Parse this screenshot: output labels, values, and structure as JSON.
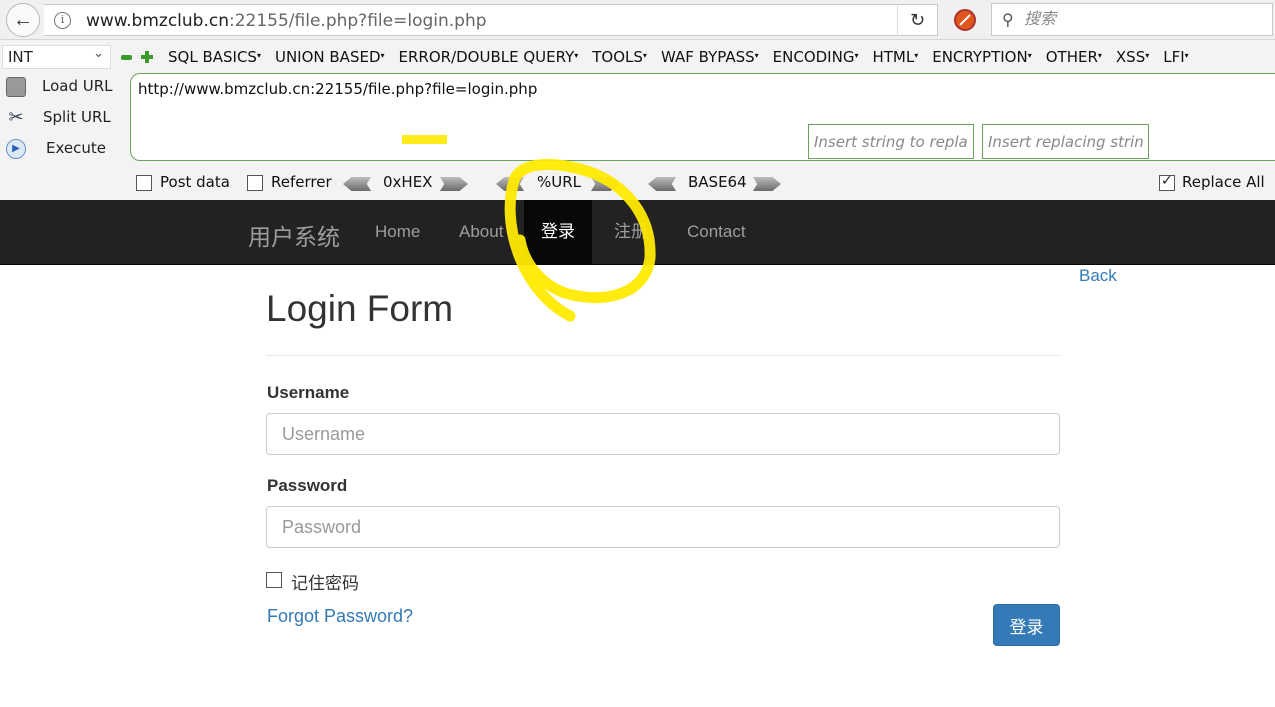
{
  "browser": {
    "url_host": "www.bmzclub.cn",
    "url_rest": ":22155/file.php?file=login.php",
    "search_placeholder": "搜索"
  },
  "hackbar": {
    "encoding_select": "INT",
    "menus": [
      "SQL BASICS",
      "UNION BASED",
      "ERROR/DOUBLE QUERY",
      "TOOLS",
      "WAF BYPASS",
      "ENCODING",
      "HTML",
      "ENCRYPTION",
      "OTHER",
      "XSS",
      "LFI"
    ],
    "load_url": "Load URL",
    "split_url": "Split URL",
    "execute": "Execute",
    "url_value": "http://www.bmzclub.cn:22155/file.php?file=login.php",
    "post_data": "Post data",
    "referrer": "Referrer",
    "hex": "0xHEX",
    "url_enc": "%URL",
    "base64": "BASE64",
    "replace_placeholder": "Insert string to replace",
    "replacing_placeholder": "Insert replacing string",
    "replace_all": "Replace All",
    "replace_all_checked": true
  },
  "navbar": {
    "brand": "用户系统",
    "items": [
      "Home",
      "About",
      "登录",
      "注册",
      "Contact"
    ],
    "active_item": "登录"
  },
  "content": {
    "back": "Back",
    "title": "Login Form",
    "username_label": "Username",
    "username_placeholder": "Username",
    "password_label": "Password",
    "password_placeholder": "Password",
    "remember": "记住密码",
    "forgot": "Forgot Password?",
    "submit": "登录"
  },
  "colors": {
    "annotation": "#ffea00",
    "link": "#337ab7",
    "navbar_bg": "#222222"
  }
}
